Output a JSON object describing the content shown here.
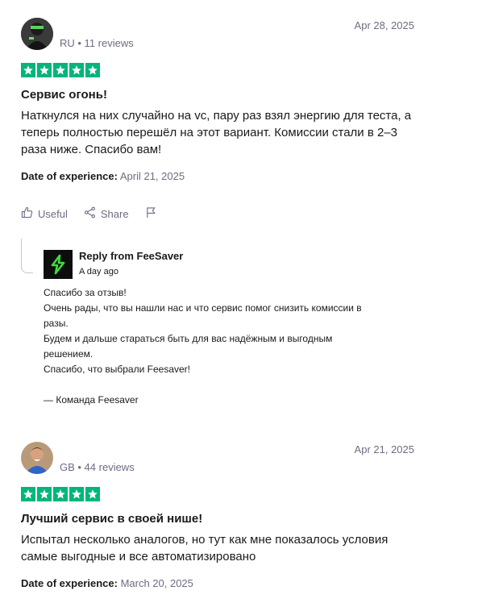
{
  "reviews": [
    {
      "author_meta": "RU • 11 reviews",
      "date": "Apr 28, 2025",
      "rating": 5,
      "title": "Сервис огонь!",
      "text": "Наткнулся на них случайно на vc, пару раз взял энергию для теста, а\nтеперь полностью перешёл на этот вариант. Комиссии стали в 2–3\nраза ниже. Спасибо вам!",
      "experience_label": "Date of experience:",
      "experience_date": "April 21, 2025",
      "actions": {
        "useful": "Useful",
        "share": "Share"
      },
      "reply": {
        "from": "Reply from FeeSaver",
        "age": "A day ago",
        "text": "Спасибо за отзыв!\nОчень рады, что вы нашли нас и что сервис помог снизить комиссии в\nразы.\nБудем и дальше стараться быть для вас надёжным и выгодным\nрешением.\nСпасибо, что выбрали Feesaver!\n\n— Команда Feesaver"
      }
    },
    {
      "author_meta": "GB • 44 reviews",
      "date": "Apr 21, 2025",
      "rating": 5,
      "title": "Лучший сервис в своей нише!",
      "text": "Испытал несколько аналогов, но тут как мне показалось условия\nсамые выгодные и все автоматизировано",
      "experience_label": "Date of experience:",
      "experience_date": "March 20, 2025"
    }
  ],
  "colors": {
    "star_green": "#00b67a",
    "muted": "#6c6c85",
    "logo_green": "#3ddc3d"
  },
  "icons": {
    "useful": "thumbs-up-icon",
    "share": "share-icon",
    "report": "flag-icon",
    "star": "star-icon"
  }
}
